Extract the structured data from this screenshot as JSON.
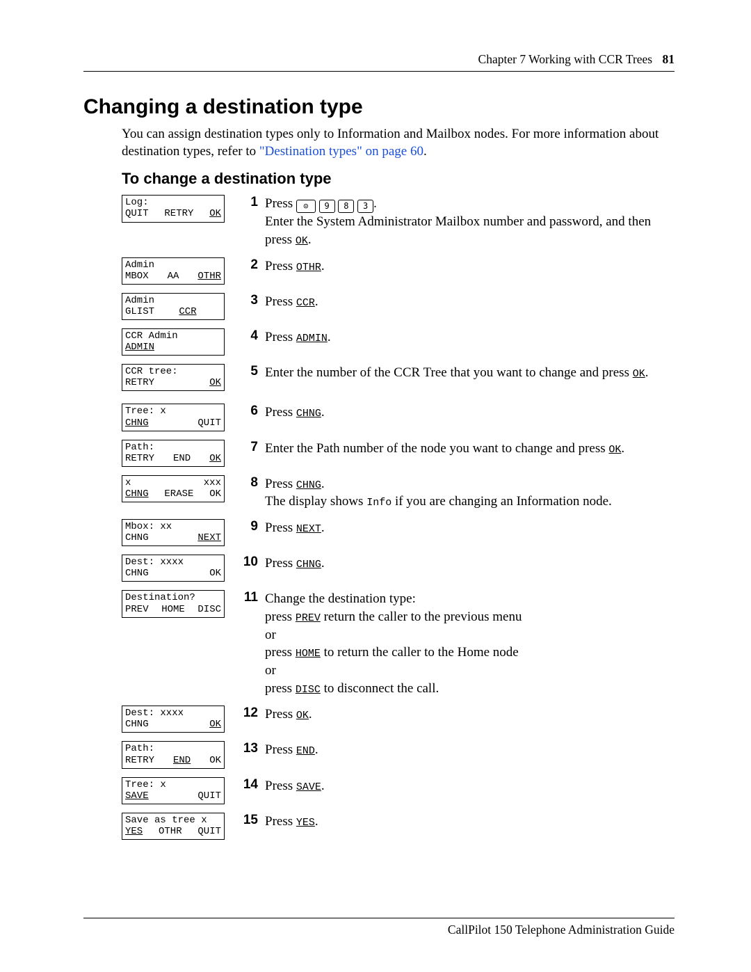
{
  "header": {
    "chapter_label": "Chapter 7  Working with CCR Trees",
    "page_number": "81"
  },
  "title": "Changing a destination type",
  "intro_pre": "You can assign destination types only to Information and Mailbox nodes. For more information about destination types, refer to ",
  "intro_link": "\"Destination types\" on page 60",
  "intro_post": ".",
  "subtitle": "To change a destination type",
  "dial": {
    "d1": "9",
    "d2": "8",
    "d3": "3"
  },
  "steps": [
    {
      "lcd": {
        "line1_l": "Log:",
        "line1_r": "",
        "l2a": "QUIT",
        "l2a_u": false,
        "l2b": "RETRY",
        "l2b_u": false,
        "l2c": "OK",
        "l2c_u": true
      },
      "num": "1",
      "text_parts": [
        "Press ",
        "#DIAL#",
        ".\nEnter the System Administrator Mailbox number and password, and then press ",
        "#SK_OK#",
        "."
      ]
    },
    {
      "gap": true,
      "lcd": {
        "line1_l": "Admin",
        "line1_r": "",
        "l2a": "MBOX",
        "l2a_u": false,
        "l2b": "AA",
        "l2b_u": false,
        "l2c": "OTHR",
        "l2c_u": true
      },
      "num": "2",
      "text_parts": [
        "Press ",
        "#SK_OTHR#",
        "."
      ]
    },
    {
      "lcd": {
        "line1_l": "Admin",
        "line1_r": "",
        "l2a": "GLIST",
        "l2a_u": false,
        "l2b": "CCR",
        "l2b_u": true,
        "l2c": "",
        "l2c_u": false
      },
      "num": "3",
      "text_parts": [
        "Press ",
        "#SK_CCR#",
        "."
      ]
    },
    {
      "lcd": {
        "line1_l": "CCR Admin",
        "line1_r": "",
        "l2a": "ADMIN",
        "l2a_u": true,
        "l2b": "",
        "l2b_u": false,
        "l2c": "",
        "l2c_u": false
      },
      "num": "4",
      "text_parts": [
        "Press ",
        "#SK_ADMIN#",
        "."
      ]
    },
    {
      "lcd": {
        "line1_l": "CCR tree:",
        "line1_r": "",
        "l2a": "RETRY",
        "l2a_u": false,
        "l2b": "",
        "l2b_u": false,
        "l2c": "OK",
        "l2c_u": true
      },
      "num": "5",
      "text_parts": [
        "Enter the number of the CCR Tree that you want to change and press ",
        "#SK_OK#",
        "."
      ]
    },
    {
      "gap": true,
      "lcd": {
        "line1_l": "Tree: x",
        "line1_r": "",
        "l2a": "CHNG",
        "l2a_u": true,
        "l2b": "",
        "l2b_u": false,
        "l2c": "QUIT",
        "l2c_u": false
      },
      "num": "6",
      "text_parts": [
        "Press ",
        "#SK_CHNG#",
        "."
      ]
    },
    {
      "lcd": {
        "line1_l": "Path:",
        "line1_r": "",
        "l2a": "RETRY",
        "l2a_u": false,
        "l2b": "END",
        "l2b_u": false,
        "l2c": "OK",
        "l2c_u": true
      },
      "num": "7",
      "text_parts": [
        "Enter the Path number of the node you want to change and press ",
        "#SK_OK#",
        "."
      ]
    },
    {
      "lcd": {
        "line1_l": "x",
        "line1_r": "xxx",
        "l2a": "CHNG",
        "l2a_u": true,
        "l2b": "ERASE",
        "l2b_u": false,
        "l2c": "OK",
        "l2c_u": false
      },
      "num": "8",
      "text_parts": [
        "Press ",
        "#SK_CHNG#",
        ".\nThe display shows ",
        "#MONO_Info#",
        " if you are changing an Information node."
      ]
    },
    {
      "gap": true,
      "lcd": {
        "line1_l": "Mbox: xx",
        "line1_r": "",
        "l2a": "CHNG",
        "l2a_u": false,
        "l2b": "",
        "l2b_u": false,
        "l2c": "NEXT",
        "l2c_u": true
      },
      "num": "9",
      "text_parts": [
        "Press ",
        "#SK_NEXT#",
        "."
      ]
    },
    {
      "lcd": {
        "line1_l": "Dest: xxxx",
        "line1_r": "",
        "l2a": "CHNG",
        "l2a_u": false,
        "l2b": "",
        "l2b_u": false,
        "l2c": "OK",
        "l2c_u": false
      },
      "num": "10",
      "text_parts": [
        "Press ",
        "#SK_CHNG#",
        "."
      ]
    },
    {
      "lcd": {
        "line1_l": "Destination?",
        "line1_r": "",
        "l2a": "PREV",
        "l2a_u": false,
        "l2b": "HOME",
        "l2b_u": false,
        "l2c": "DISC",
        "l2c_u": false
      },
      "num": "11",
      "text_parts": [
        "Change the destination type:\npress ",
        "#SK_PREV#",
        " return the caller to the previous menu\nor\npress ",
        "#SK_HOME#",
        " to return the caller to the Home node\nor\npress ",
        "#SK_DISC#",
        " to disconnect the call."
      ]
    },
    {
      "gap": true,
      "lcd": {
        "line1_l": "Dest: xxxx",
        "line1_r": "",
        "l2a": "CHNG",
        "l2a_u": false,
        "l2b": "",
        "l2b_u": false,
        "l2c": "OK",
        "l2c_u": true
      },
      "num": "12",
      "text_parts": [
        "Press ",
        "#SK_OK#",
        "."
      ]
    },
    {
      "lcd": {
        "line1_l": "Path:",
        "line1_r": "",
        "l2a": "RETRY",
        "l2a_u": false,
        "l2b": "END",
        "l2b_u": true,
        "l2c": "OK",
        "l2c_u": false
      },
      "num": "13",
      "text_parts": [
        "Press ",
        "#SK_END#",
        "."
      ]
    },
    {
      "lcd": {
        "line1_l": "Tree: x",
        "line1_r": "",
        "l2a": "SAVE",
        "l2a_u": true,
        "l2b": "",
        "l2b_u": false,
        "l2c": "QUIT",
        "l2c_u": false
      },
      "num": "14",
      "text_parts": [
        "Press ",
        "#SK_SAVE#",
        "."
      ]
    },
    {
      "lcd": {
        "line1_l": "Save as tree x",
        "line1_r": "",
        "l2a": "YES",
        "l2a_u": true,
        "l2b": "OTHR",
        "l2b_u": false,
        "l2c": "QUIT",
        "l2c_u": false
      },
      "num": "15",
      "text_parts": [
        "Press ",
        "#SK_YES#",
        "."
      ]
    }
  ],
  "sk_labels": {
    "OK": "OK",
    "OTHR": "OTHR",
    "CCR": "CCR",
    "ADMIN": "ADMIN",
    "CHNG": "CHNG",
    "NEXT": "NEXT",
    "PREV": "PREV",
    "HOME": "HOME",
    "DISC": "DISC",
    "END": "END",
    "SAVE": "SAVE",
    "YES": "YES"
  },
  "mono": {
    "Info": "Info"
  },
  "footer": "CallPilot 150 Telephone Administration Guide"
}
